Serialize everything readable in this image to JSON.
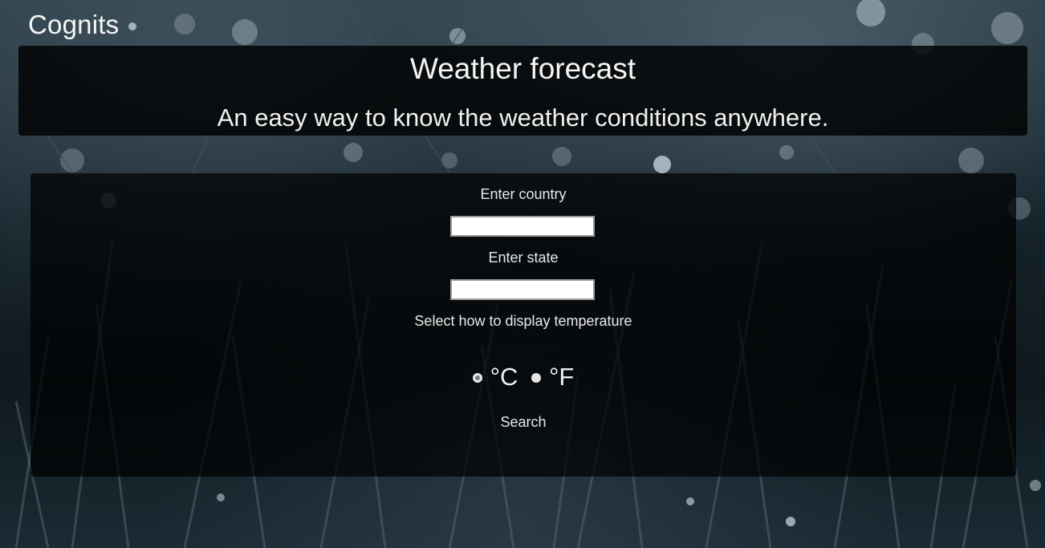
{
  "brand": {
    "name": "Cognits"
  },
  "hero": {
    "title": "Weather forecast",
    "subtitle": "An easy way to know the weather conditions anywhere."
  },
  "form": {
    "country_label": "Enter country",
    "country_value": "",
    "state_label": "Enter state",
    "state_value": "",
    "temp_label": "Select how to display temperature",
    "units": [
      {
        "label": "°C",
        "selected": true
      },
      {
        "label": "°F",
        "selected": false
      }
    ],
    "search_label": "Search"
  },
  "colors": {
    "panel_background": "#000000",
    "text": "#f0f0f0",
    "input_background": "#ffffff"
  }
}
